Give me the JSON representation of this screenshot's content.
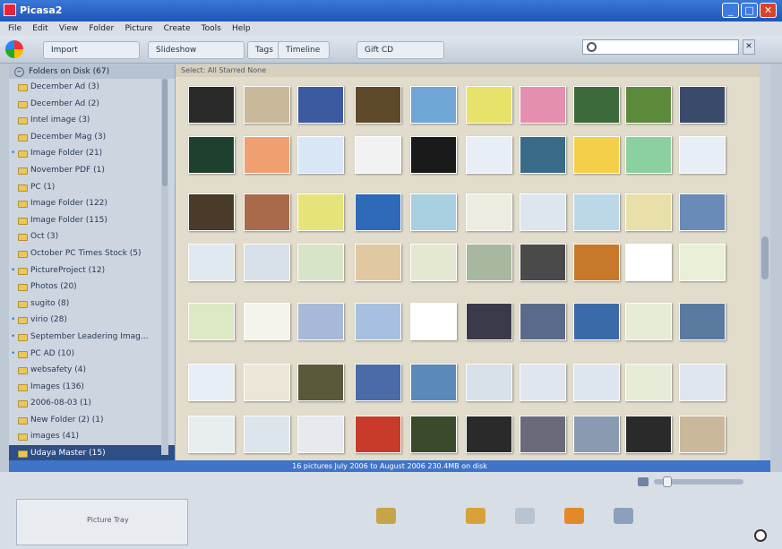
{
  "window": {
    "title": "Picasa2"
  },
  "menu": [
    "File",
    "Edit",
    "View",
    "Folder",
    "Picture",
    "Create",
    "Tools",
    "Help"
  ],
  "toolbar": {
    "import_label": "Import",
    "slideshow_label": "Slideshow",
    "tags_label": "Tags",
    "timeline_label": "Timeline",
    "gift_label": "Gift CD"
  },
  "sidebar": {
    "header": "Folders on Disk (67)",
    "items": [
      {
        "label": "December Ad (3)",
        "starred": false
      },
      {
        "label": "December Ad (2)",
        "starred": false
      },
      {
        "label": "Intel image (3)",
        "starred": false
      },
      {
        "label": "December Mag (3)",
        "starred": false
      },
      {
        "label": "Image Folder (21)",
        "starred": true
      },
      {
        "label": "November PDF (1)",
        "starred": false
      },
      {
        "label": "PC (1)",
        "starred": false
      },
      {
        "label": "Image Folder (122)",
        "starred": false
      },
      {
        "label": "Image Folder (115)",
        "starred": false
      },
      {
        "label": "Oct (3)",
        "starred": false
      },
      {
        "label": "October PC Times Stock (5)",
        "starred": false
      },
      {
        "label": "PictureProject (12)",
        "starred": true
      },
      {
        "label": "Photos (20)",
        "starred": false
      },
      {
        "label": "sugito (8)",
        "starred": false
      },
      {
        "label": "virio (28)",
        "starred": true
      },
      {
        "label": "September Leadering Imag...",
        "starred": true
      },
      {
        "label": "PC AD (10)",
        "starred": true
      },
      {
        "label": "websafety (4)",
        "starred": false
      },
      {
        "label": "Images (136)",
        "starred": false
      },
      {
        "label": "2006-08-03 (1)",
        "starred": false
      },
      {
        "label": "New Folder (2) (1)",
        "starred": false
      },
      {
        "label": "images (41)",
        "starred": false
      },
      {
        "label": "Udaya Master (15)",
        "starred": false,
        "selected": true
      }
    ]
  },
  "main": {
    "header": "Select:  All  Starred  None"
  },
  "status": {
    "text": "16 pictures    July 2006 to August 2006    230.4MB on disk"
  },
  "tray": {
    "label": "Picture Tray"
  },
  "search": {
    "placeholder": ""
  }
}
